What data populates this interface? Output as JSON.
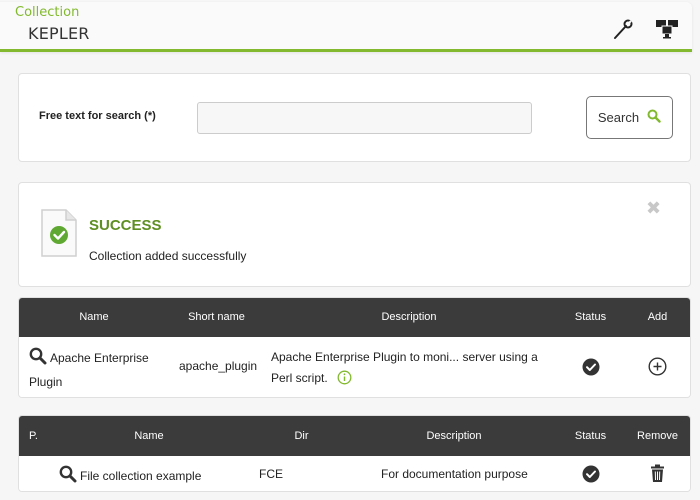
{
  "header": {
    "subtitle": "Collection",
    "title": "KEPLER",
    "icons": [
      "wrench-icon",
      "network-icon"
    ]
  },
  "search": {
    "label": "Free text for search (*)",
    "value": "",
    "placeholder": "",
    "button_label": "Search",
    "button_icon": "search-icon"
  },
  "notice": {
    "title": "SUCCESS",
    "message": "Collection added successfully",
    "icon": "document-check-icon",
    "close_icon": "close-icon"
  },
  "plugins_table": {
    "columns": [
      "Name",
      "Short name",
      "Description",
      "Status",
      "Add"
    ],
    "rows": [
      {
        "name_line1": "Apache Enterprise",
        "name_line2": "Plugin",
        "short_name": "apache_plugin",
        "description_line1": "Apache Enterprise Plugin to moni... server using a",
        "description_line2": "Perl script.",
        "status": "ok",
        "action": "add"
      }
    ]
  },
  "collections_table": {
    "columns": [
      "P.",
      "Name",
      "Dir",
      "Description",
      "Status",
      "Remove"
    ],
    "rows": [
      {
        "p": "",
        "name": "File collection example",
        "dir": "FCE",
        "description": "For documentation purpose",
        "status": "ok",
        "action": "remove"
      }
    ]
  },
  "colors": {
    "accent": "#82b92e",
    "success_title": "#5e8f22",
    "table_header": "#3b3b3b"
  }
}
